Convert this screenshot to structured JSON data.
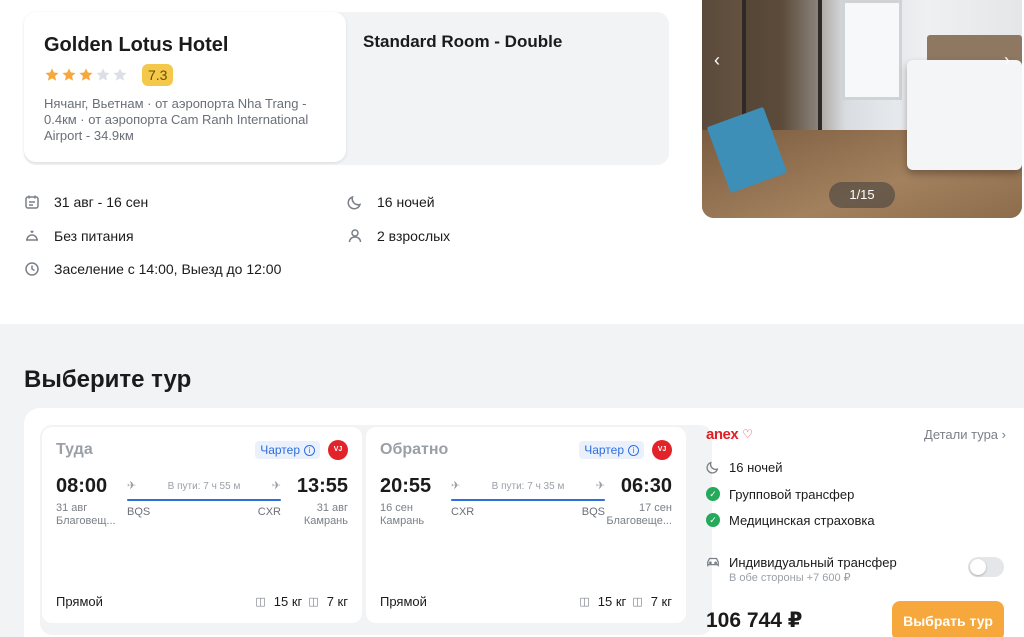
{
  "hotel": {
    "name": "Golden Lotus Hotel",
    "stars": 3,
    "stars_max": 5,
    "score": "7.3",
    "location": "Нячанг, Вьетнам · от аэропорта Nha Trang - 0.4км · от аэропорта Cam Ranh International Airport - 34.9км",
    "room": "Standard Room - Double"
  },
  "gallery": {
    "counter": "1/15",
    "prev_icon": "chevron-left-icon",
    "next_icon": "chevron-right-icon"
  },
  "facts": {
    "dates": "31 авг - 16 сен",
    "nights": "16 ночей",
    "meal": "Без питания",
    "guests": "2 взрослых",
    "checkin": "Заселение с 14:00, Выезд до 12:00"
  },
  "choose_title": "Выберите тур",
  "flights": {
    "outbound": {
      "direction": "Туда",
      "charter": "Чартер",
      "airline_logo": "vietjet",
      "dep_time": "08:00",
      "dep_date": "31 авг",
      "dep_city": "Благовещ...",
      "arr_time": "13:55",
      "arr_date": "31 авг",
      "arr_city": "Камрань",
      "duration": "В пути: 7 ч 55 м",
      "dep_code": "BQS",
      "arr_code": "CXR",
      "type": "Прямой",
      "baggage": "15 кг",
      "hand_luggage": "7 кг"
    },
    "return": {
      "direction": "Обратно",
      "charter": "Чартер",
      "airline_logo": "vietjet",
      "dep_time": "20:55",
      "dep_date": "16 сен",
      "dep_city": "Камрань",
      "arr_time": "06:30",
      "arr_date": "17 сен",
      "arr_city": "Благовеще...",
      "duration": "В пути: 7 ч 35 м",
      "dep_code": "CXR",
      "arr_code": "BQS",
      "type": "Прямой",
      "baggage": "15 кг",
      "hand_luggage": "7 кг"
    }
  },
  "operator": {
    "logo": "anex",
    "details": "Детали тура",
    "nights": "16 ночей",
    "group_transfer": "Групповой трансфер",
    "insurance": "Медицинская страховка",
    "individual_transfer": "Индивидуальный трансфер",
    "individual_transfer_note": "В обе стороны +7 600 ₽",
    "price": "106 744 ₽",
    "select": "Выбрать тур"
  },
  "colors": {
    "accent": "#f7a83d",
    "link": "#2d6fdc",
    "check": "#25a95a",
    "brand": "#e31e24",
    "score": "#f3c84b"
  }
}
